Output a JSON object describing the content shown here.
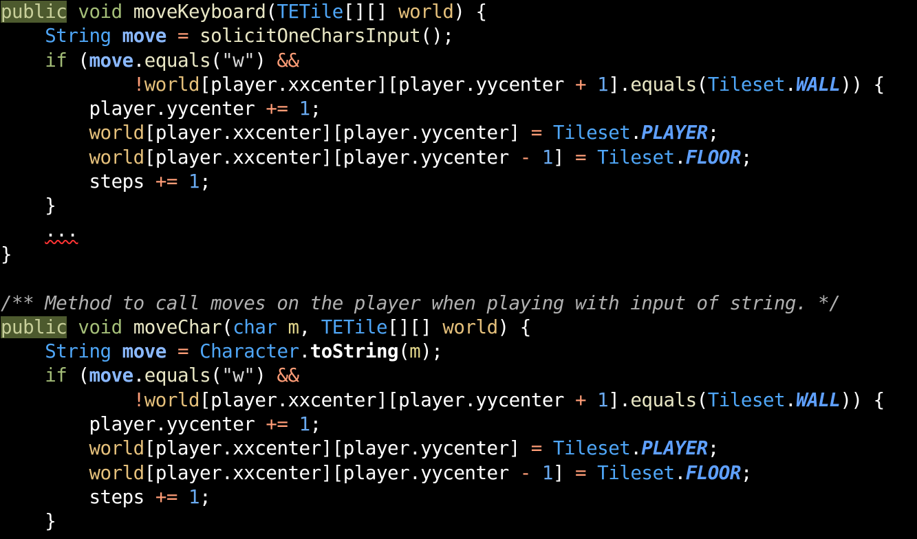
{
  "editor": {
    "lines": [
      "public void moveKeyboard(TETile[][] world) {",
      "    String move = solicitOneCharsInput();",
      "    if (move.equals(\"w\") &&",
      "            !world[player.xxcenter][player.yycenter + 1].equals(Tileset.WALL)) {",
      "        player.yycenter += 1;",
      "        world[player.xxcenter][player.yycenter] = Tileset.PLAYER;",
      "        world[player.xxcenter][player.yycenter - 1] = Tileset.FLOOR;",
      "        steps += 1;",
      "    }",
      "    ...",
      "}",
      "",
      "/** Method to call moves on the player when playing with input of string. */",
      "public void moveChar(char m, TETile[][] world) {",
      "    String move = Character.toString(m);",
      "    if (move.equals(\"w\") &&",
      "            !world[player.xxcenter][player.yycenter + 1].equals(Tileset.WALL)) {",
      "        player.yycenter += 1;",
      "        world[player.xxcenter][player.yycenter] = Tileset.PLAYER;",
      "        world[player.xxcenter][player.yycenter - 1] = Tileset.FLOOR;",
      "        steps += 1;",
      "    }"
    ],
    "colors": {
      "background": "#000000",
      "keyword": "#a4be78",
      "type": "#4fa6f7",
      "constant": "#5fa0ff",
      "field": "#e5c07b",
      "operator": "#ff9d77",
      "comment": "#b0b0b0",
      "error_squiggle": "#ff3333"
    }
  }
}
